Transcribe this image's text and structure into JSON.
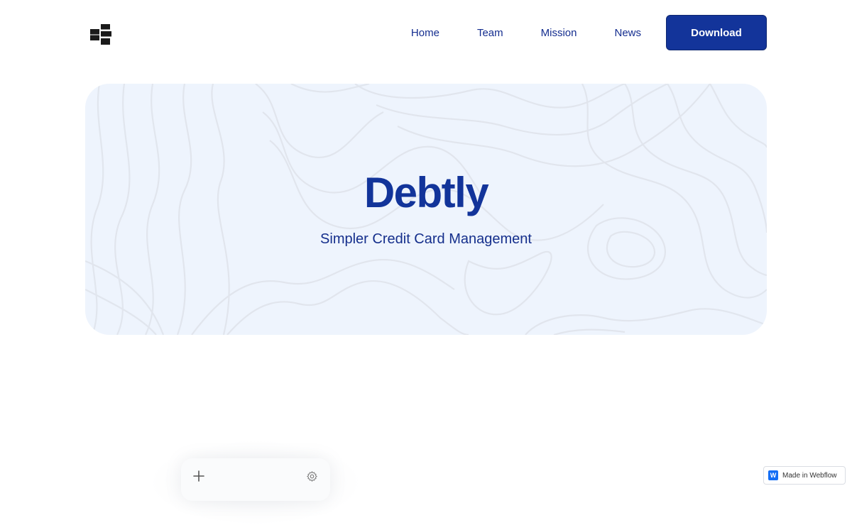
{
  "nav": {
    "logo_icon": "stacked-blocks-logo-icon",
    "links": [
      "Home",
      "Team",
      "Mission",
      "News"
    ],
    "download_label": "Download"
  },
  "hero": {
    "title": "Debtly",
    "subtitle": "Simpler Credit Card Management",
    "background_pattern": "topographic-lines"
  },
  "phone_preview": {
    "icons": [
      "plus-icon",
      "gear-icon"
    ]
  },
  "badge": {
    "logo_letter": "W",
    "label": "Made in Webflow"
  },
  "colors": {
    "brand_blue": "#13349a",
    "hero_background": "#eef4fd",
    "text_primary": "#142d8f"
  }
}
